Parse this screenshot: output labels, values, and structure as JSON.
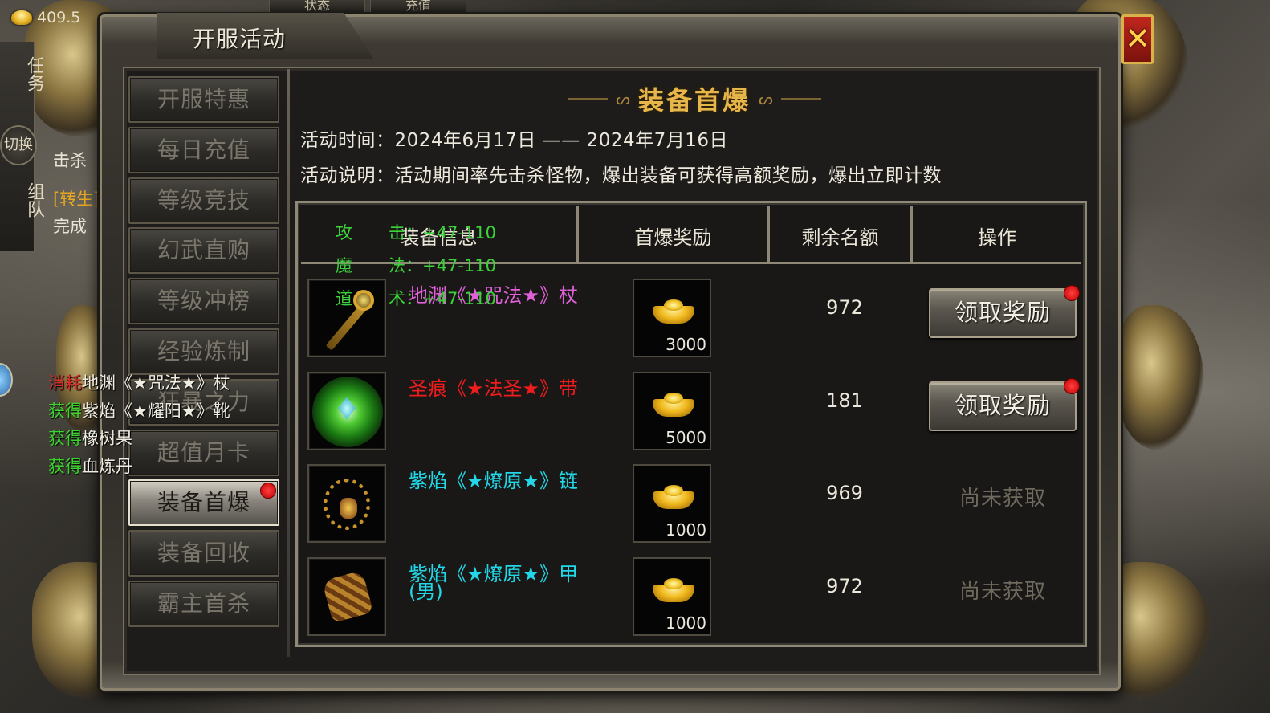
{
  "hud": {
    "gold": "409.5",
    "top_tabs": [
      "状态",
      "充值"
    ]
  },
  "left_hud": {
    "quest_label": "任务",
    "switch_label": "切换",
    "team_label": "组队",
    "quest_lines": [
      "击杀",
      "[转生]",
      "完成"
    ]
  },
  "chat_log": [
    {
      "action": "消耗",
      "action_color": "#e0282a",
      "text": "地渊《★咒法★》杖"
    },
    {
      "action": "获得",
      "action_color": "#3bd42e",
      "text": "紫焰《★耀阳★》靴"
    },
    {
      "action": "获得",
      "action_color": "#3bd42e",
      "text": "橡树果"
    },
    {
      "action": "获得",
      "action_color": "#3bd42e",
      "text": "血炼丹"
    }
  ],
  "window": {
    "title": "开服活动",
    "close_label": "✕"
  },
  "sidebar": {
    "items": [
      {
        "label": "开服特惠",
        "active": false,
        "dot": false
      },
      {
        "label": "每日充值",
        "active": false,
        "dot": false
      },
      {
        "label": "等级竞技",
        "active": false,
        "dot": false
      },
      {
        "label": "幻武直购",
        "active": false,
        "dot": false
      },
      {
        "label": "等级冲榜",
        "active": false,
        "dot": false
      },
      {
        "label": "经验炼制",
        "active": false,
        "dot": false
      },
      {
        "label": "狂暴之力",
        "active": false,
        "dot": false
      },
      {
        "label": "超值月卡",
        "active": false,
        "dot": false
      },
      {
        "label": "装备首爆",
        "active": true,
        "dot": true
      },
      {
        "label": "装备回收",
        "active": false,
        "dot": false
      },
      {
        "label": "霸主首杀",
        "active": false,
        "dot": false
      }
    ]
  },
  "content": {
    "heading": "装备首爆",
    "activity_time": "活动时间：2024年6月17日 —— 2024年7月16日",
    "activity_desc": "活动说明：活动期间率先击杀怪物，爆出装备可获得高额奖励，爆出立即计数"
  },
  "table": {
    "headers": [
      "装备信息",
      "首爆奖励",
      "剩余名额",
      "操作"
    ],
    "rows": [
      {
        "name": "地渊《★咒法★》杖",
        "name_color": "#e060d8",
        "icon": "staff-icon",
        "reward": "3000",
        "remaining": "972",
        "action": "领取奖励",
        "claimable": true
      },
      {
        "name": "圣痕《★法圣★》带",
        "name_color": "#ee1c1c",
        "icon": "belt-icon",
        "reward": "5000",
        "remaining": "181",
        "action": "领取奖励",
        "claimable": true
      },
      {
        "name": "紫焰《★燎原★》链",
        "name_color": "#22d8e8",
        "icon": "necklace-icon",
        "reward": "1000",
        "remaining": "969",
        "action": "尚未获取",
        "claimable": false
      },
      {
        "name": "紫焰《★燎原★》甲(男)",
        "name_color": "#22d8e8",
        "icon": "armor-icon",
        "reward": "1000",
        "remaining": "972",
        "action": "尚未获取",
        "claimable": false
      }
    ]
  },
  "tooltip": {
    "lines": [
      {
        "key": "攻",
        "value": "击：+47-110"
      },
      {
        "key": "魔",
        "value": "法：+47-110"
      },
      {
        "key": "道",
        "value": "术：+47-110"
      }
    ]
  }
}
